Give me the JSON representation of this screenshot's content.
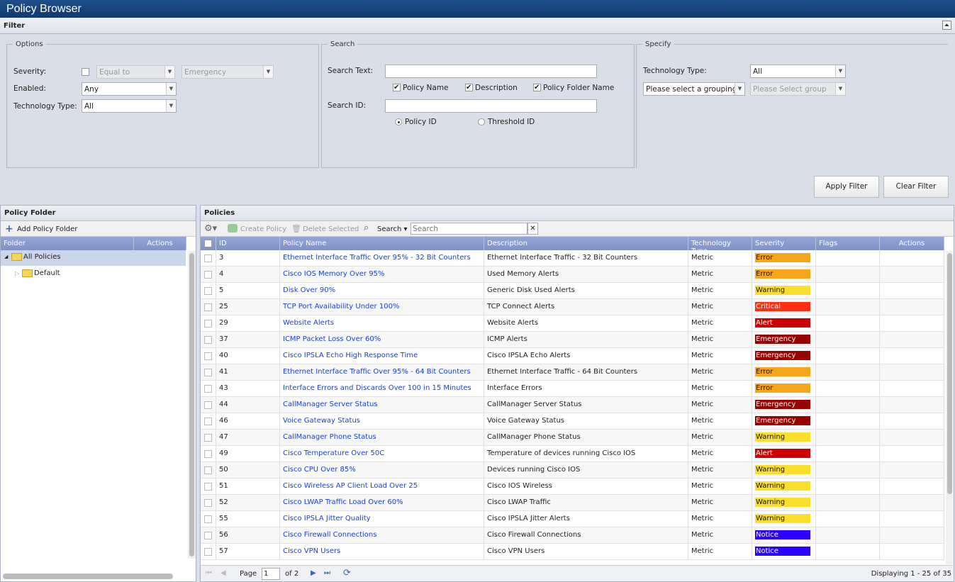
{
  "title": "Policy Browser",
  "filter": {
    "header": "Filter",
    "options": {
      "legend": "Options",
      "severity_label": "Severity:",
      "severity_op": "Equal to",
      "severity_value": "Emergency",
      "enabled_label": "Enabled:",
      "enabled_value": "Any",
      "tech_label": "Technology Type:",
      "tech_value": "All"
    },
    "search": {
      "legend": "Search",
      "text_label": "Search Text:",
      "text_value": "",
      "cb_policy_name": "Policy Name",
      "cb_description": "Description",
      "cb_folder": "Policy Folder Name",
      "id_label": "Search ID:",
      "id_value": "",
      "radio_policy_id": "Policy ID",
      "radio_threshold_id": "Threshold ID"
    },
    "specify": {
      "legend": "Specify",
      "tech_label": "Technology Type:",
      "tech_value": "All",
      "grouping": "Please select a grouping",
      "group": "Please Select group"
    },
    "apply": "Apply Filter",
    "clear": "Clear Filter"
  },
  "folders": {
    "header": "Policy Folder",
    "add": "Add Policy Folder",
    "col_folder": "Folder",
    "col_actions": "Actions",
    "items": [
      "All Policies",
      "Default"
    ]
  },
  "policies": {
    "header": "Policies",
    "create": "Create Policy",
    "delete": "Delete Selected",
    "search_btn": "Search",
    "search_placeholder": "Search",
    "columns": [
      "ID",
      "Policy Name",
      "Description",
      "Technology Type",
      "Severity",
      "Flags",
      "Actions"
    ],
    "rows": [
      [
        "3",
        "Ethernet Interface Traffic Over 95% - 32 Bit Counters",
        "Ethernet Interface Traffic - 32 Bit Counters",
        "Metric",
        "Error"
      ],
      [
        "4",
        "Cisco IOS Memory Over 95%",
        "Used Memory Alerts",
        "Metric",
        "Error"
      ],
      [
        "5",
        "Disk Over 90%",
        "Generic Disk Used Alerts",
        "Metric",
        "Warning"
      ],
      [
        "25",
        "TCP Port Availability Under 100%",
        "TCP Connect Alerts",
        "Metric",
        "Critical"
      ],
      [
        "29",
        "Website Alerts",
        "Website Alerts",
        "Metric",
        "Alert"
      ],
      [
        "37",
        "ICMP Packet Loss Over 60%",
        "ICMP Alerts",
        "Metric",
        "Emergency"
      ],
      [
        "40",
        "Cisco IPSLA Echo High Response Time",
        "Cisco IPSLA Echo Alerts",
        "Metric",
        "Emergency"
      ],
      [
        "41",
        "Ethernet Interface Traffic Over 95% - 64 Bit Counters",
        "Ethernet Interface Traffic - 64 Bit Counters",
        "Metric",
        "Error"
      ],
      [
        "43",
        "Interface Errors and Discards Over 100 in 15 Minutes",
        "Interface Errors",
        "Metric",
        "Error"
      ],
      [
        "44",
        "CallManager Server Status",
        "CallManager Server Status",
        "Metric",
        "Emergency"
      ],
      [
        "46",
        "Voice Gateway Status",
        "Voice Gateway Status",
        "Metric",
        "Emergency"
      ],
      [
        "47",
        "CallManager Phone Status",
        "CallManager Phone Status",
        "Metric",
        "Warning"
      ],
      [
        "49",
        "Cisco Temperature Over 50C",
        "Temperature of devices running Cisco IOS",
        "Metric",
        "Alert"
      ],
      [
        "50",
        "Cisco CPU Over 85%",
        "Devices running Cisco IOS",
        "Metric",
        "Warning"
      ],
      [
        "51",
        "Cisco Wireless AP Client Load Over 25",
        "Cisco IOS Wireless",
        "Metric",
        "Warning"
      ],
      [
        "52",
        "Cisco LWAP Traffic Load Over 60%",
        "Cisco LWAP Traffic",
        "Metric",
        "Warning"
      ],
      [
        "55",
        "Cisco IPSLA Jitter Quality",
        "Cisco IPSLA Jitter Alerts",
        "Metric",
        "Warning"
      ],
      [
        "56",
        "Cisco Firewall Connections",
        "Cisco Firewall Connections",
        "Metric",
        "Notice"
      ],
      [
        "57",
        "Cisco VPN Users",
        "Cisco VPN Users",
        "Metric",
        "Notice"
      ]
    ],
    "severity_colors": {
      "Error": "#f7a51b",
      "Warning": "#fbdf2c",
      "Critical": "#ff2e12",
      "Alert": "#cc0000",
      "Emergency": "#990000",
      "Notice": "#2a00ff"
    },
    "paging": {
      "page_label": "Page",
      "page": "1",
      "of": "of 2",
      "display": "Displaying 1 - 25 of 35"
    }
  }
}
